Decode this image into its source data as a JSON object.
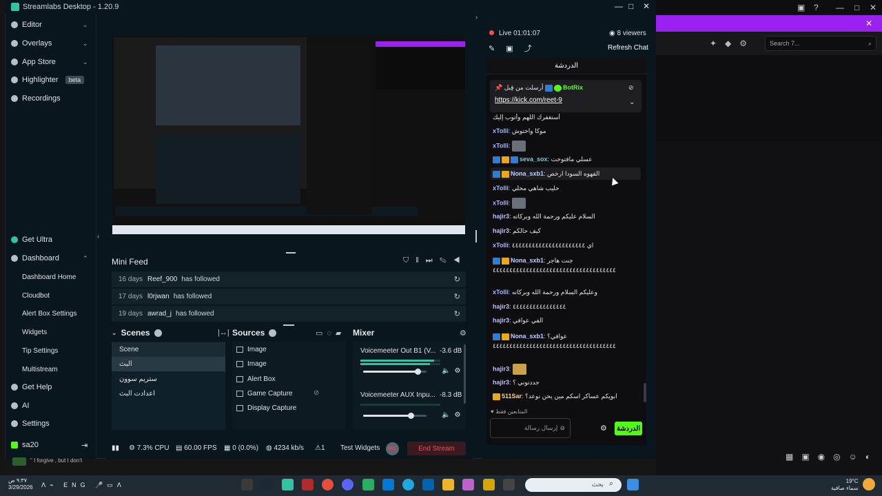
{
  "window": {
    "title": "Streamlabs Desktop - 1.20.9"
  },
  "sidebar": {
    "items": [
      {
        "label": "Editor"
      },
      {
        "label": "Overlays"
      },
      {
        "label": "App Store"
      },
      {
        "label": "Highlighter",
        "badge": "beta"
      },
      {
        "label": "Recordings"
      }
    ],
    "bottom": [
      {
        "label": "Get Ultra"
      },
      {
        "label": "Dashboard"
      },
      {
        "label": "Get Help"
      },
      {
        "label": "AI"
      },
      {
        "label": "Settings"
      },
      {
        "label": "sa20"
      }
    ],
    "dashboard_sub": [
      "Dashboard Home",
      "Cloudbot",
      "Alert Box Settings",
      "Widgets",
      "Tip Settings",
      "Multistream"
    ]
  },
  "mini_feed": {
    "title": "Mini Feed",
    "rows": [
      {
        "days": "16 days",
        "user": "Reef_900",
        "action": "has followed"
      },
      {
        "days": "17 days",
        "user": "l0rjwan",
        "action": "has followed"
      },
      {
        "days": "19 days",
        "user": "awrad_j",
        "action": "has followed"
      }
    ]
  },
  "scenes": {
    "title": "Scenes",
    "items": [
      "Scene",
      "البث",
      "ستريم سوون",
      "اعدادت البث"
    ]
  },
  "sources": {
    "title": "Sources",
    "items": [
      "Image",
      "Image",
      "Alert Box",
      "Game Capture",
      "Display Capture"
    ]
  },
  "mixer": {
    "title": "Mixer",
    "channels": [
      {
        "name": "Voicemeeter Out B1 (V...",
        "db": "-3.6 dB",
        "level": 0.92,
        "volume": 0.86
      },
      {
        "name": "Voicemeeter AUX Inpu...",
        "db": "-8.3 dB",
        "level": 0.0,
        "volume": 0.75
      }
    ]
  },
  "status": {
    "cpu": "7.3% CPU",
    "fps": "60.00 FPS",
    "dropped": "0 (0.0%)",
    "bitrate": "4234 kb/s",
    "alerts": "1",
    "test_widgets": "Test Widgets",
    "rec": "REC",
    "end_stream": "End Stream"
  },
  "chat": {
    "live": "Live 01:01:07",
    "viewers": "8 viewers",
    "refresh": "Refresh Chat",
    "header": "الدردشة",
    "pinned_by": "أرسلت من قِبل",
    "pinned_user": "BotRix",
    "pinned_link": "https://kick.com/reet-9",
    "messages": [
      {
        "user": "",
        "text": "أستغفرك اللهم وأتوب إليك"
      },
      {
        "user": "xTolli",
        "text": "موكا واختوش"
      },
      {
        "user": "xTolli",
        "text": ""
      },
      {
        "user": "seva_sox",
        "text": "عسلي مافتوخت"
      },
      {
        "user": "Nona_sxb1",
        "text": "القهوه السودا ارخص"
      },
      {
        "user": "xTolli",
        "text": "حليب شاهي محلي"
      },
      {
        "user": "xTolli",
        "text": ""
      },
      {
        "user": "hajir3",
        "text": "السلام عليكم ورحمة الله وبركاته"
      },
      {
        "user": "hajir3",
        "text": "كيف حالكم"
      },
      {
        "user": "xTolli",
        "text": "اي ٤٤٤٤٤٤٤٤٤٤٤٤٤٤٤٤٤٤٤٤٤٤"
      },
      {
        "user": "Nona_sxb1",
        "text": "جنت هاجر ٤٤٤٤٤٤٤٤٤٤٤٤٤٤٤٤٤٤٤٤٤٤٤٤٤٤٤٤٤٤٤٤٤٤٤٤٤"
      },
      {
        "user": "xTolli",
        "text": "وعليكم السلام ورحمة الله وبركاته"
      },
      {
        "user": "hajir3",
        "text": "٤٤٤٤٤٤٤٤٤٤٤٤٤٤٤٤"
      },
      {
        "user": "hajir3",
        "text": "الفي عوافي"
      },
      {
        "user": "Nona_sxb1",
        "text": "عوافي؟ ٤٤٤٤٤٤٤٤٤٤٤٤٤٤٤٤٤٤٤٤٤٤٤٤٤٤٤٤٤٤٤٤٤٤٤٤٤"
      },
      {
        "user": "hajir3",
        "text": ""
      },
      {
        "user": "hajir3",
        "text": "جددتوني ؟"
      },
      {
        "user": "511Sar",
        "text": "ابويكم عساكر اسكم مين يحن نوعد؟"
      }
    ],
    "mute_note": "المتابعين فقط",
    "input_placeholder": "إرسال رسالة",
    "send": "الدردشة"
  },
  "browser": {
    "search_placeholder": "Search 7..."
  },
  "strip": {
    "text": "\" I forgive , but I don't"
  },
  "taskbar": {
    "time": "٩:٣٧ ص",
    "date": "3/29/2026",
    "lang": "ENG",
    "search": "بحث",
    "temp": "19°C",
    "weather": "سماء صافية"
  }
}
